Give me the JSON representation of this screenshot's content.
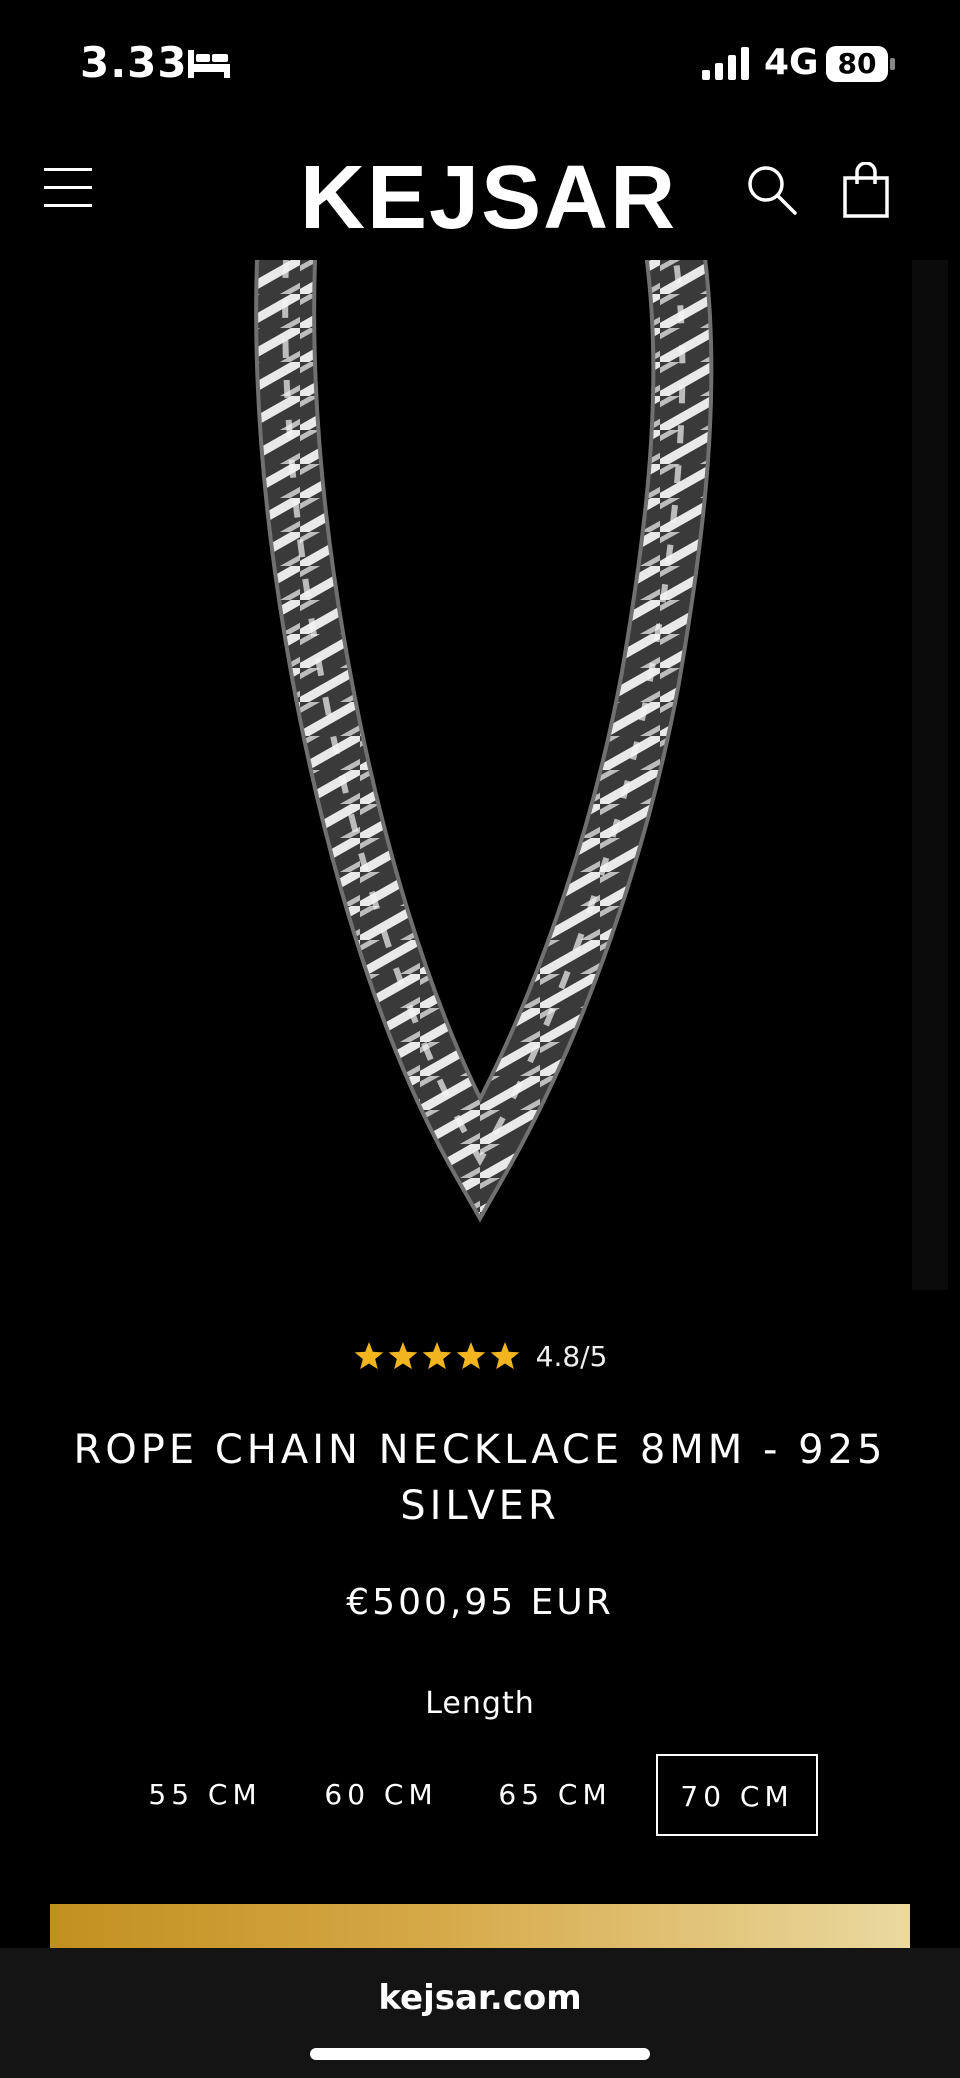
{
  "status_bar": {
    "time": "3.33",
    "network": "4G",
    "battery": "80",
    "icons": [
      "sleep-bed-icon",
      "signal-bars-icon",
      "battery-icon"
    ]
  },
  "header": {
    "logo": "KEJSAR",
    "icons": [
      "menu-icon",
      "search-icon",
      "cart-bag-icon"
    ]
  },
  "product": {
    "image_icon": "rope-chain-necklace-image",
    "rating_stars": 5,
    "rating_text": "4.8/5",
    "title": "ROPE CHAIN NECKLACE 8MM - 925 SILVER",
    "price": "€500,95 EUR",
    "length_label": "Length",
    "length_options": [
      "55 CM",
      "60 CM",
      "65 CM",
      "70 CM"
    ],
    "selected_length": "70 CM"
  },
  "colors": {
    "background": "#000000",
    "star": "#f2b51f",
    "button_gradient_start": "#c2901f",
    "button_gradient_end": "#ead9a0"
  },
  "browser": {
    "url": "kejsar.com"
  }
}
